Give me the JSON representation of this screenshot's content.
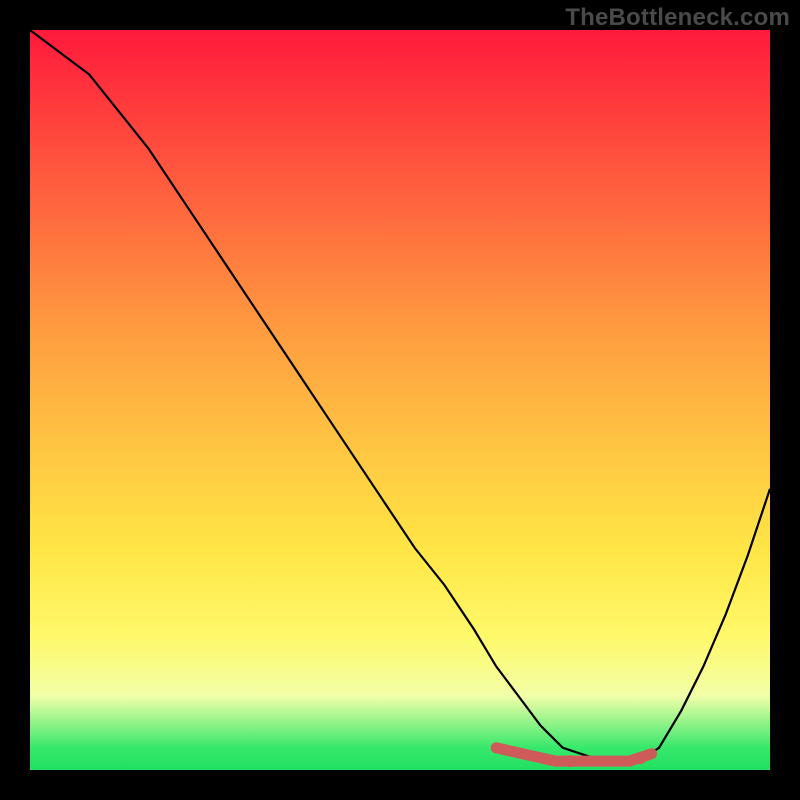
{
  "watermark": "TheBottleneck.com",
  "colors": {
    "background": "#000000",
    "gradient_top": "#ff1a3c",
    "gradient_mid": "#ffe545",
    "gradient_bottom": "#20e060",
    "curve": "#000000",
    "marker": "#cf5a5a"
  },
  "chart_data": {
    "type": "line",
    "title": "",
    "xlabel": "",
    "ylabel": "",
    "x_range": [
      0,
      100
    ],
    "y_range": [
      0,
      100
    ],
    "note": "x and y are percent of plot area from left and bottom respectively; curve appears to show bottleneck mismatch vs some parameter, reaching a minimum (~0) around x≈72–82 then rising again.",
    "series": [
      {
        "name": "curve",
        "x": [
          0,
          4,
          8,
          12,
          16,
          20,
          24,
          28,
          32,
          36,
          40,
          44,
          48,
          52,
          56,
          60,
          63,
          66,
          69,
          72,
          75,
          78,
          80,
          82,
          85,
          88,
          91,
          94,
          97,
          100
        ],
        "y": [
          100,
          97,
          94,
          89,
          84,
          78,
          72,
          66,
          60,
          54,
          48,
          42,
          36,
          30,
          25,
          19,
          14,
          10,
          6,
          3,
          2,
          1,
          1,
          1,
          3,
          8,
          14,
          21,
          29,
          38
        ]
      }
    ],
    "markers": {
      "name": "highlighted-minimum",
      "segments": [
        {
          "x": [
            63,
            71
          ],
          "y": [
            3,
            1.2
          ]
        },
        {
          "x": [
            71,
            81
          ],
          "y": [
            1.2,
            1.2
          ]
        },
        {
          "x": [
            81,
            84
          ],
          "y": [
            1.2,
            2.2
          ]
        }
      ],
      "dots": [
        {
          "x": 73,
          "y": 1.2
        },
        {
          "x": 82.5,
          "y": 1.6
        }
      ]
    }
  }
}
